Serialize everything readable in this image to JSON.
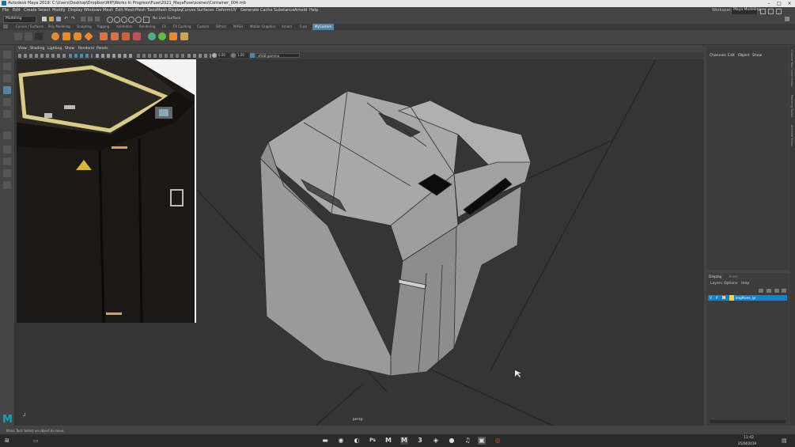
{
  "title_bar": {
    "title": "Autodesk Maya 2019: C:\\Users\\Desktop\\Dropbox\\WIP\\Works In Progress\\Fuse\\2021_MayaFuse\\scenes\\Container_004.mb"
  },
  "menu_bar": {
    "items": [
      "File",
      "Edit",
      "Create",
      "Select",
      "Modify",
      "Display",
      "Windows",
      "Mesh",
      "Edit Mesh",
      "Mesh Tools",
      "Mesh Display",
      "Curves",
      "Surfaces",
      "Deform",
      "UV",
      "Generate",
      "Cache",
      "Substance",
      "Arnold",
      "Help"
    ],
    "workspace_label": "Workspace :",
    "workspace_value": "Maya Modeling"
  },
  "status_line": {
    "mode": "Modeling",
    "live_surface": "No Live Surface"
  },
  "shelf_tabs": [
    "Curves / Surfaces",
    "Poly Modeling",
    "Sculpting",
    "Rigging",
    "Animation",
    "Rendering",
    "FX",
    "FX Caching",
    "Custom",
    "Bifrost",
    "MASH",
    "Motion Graphics",
    "Arnold",
    "Fuse",
    "MyCustom"
  ],
  "active_shelf_tab": "MyCustom",
  "panel_menu": [
    "View",
    "Shading",
    "Lighting",
    "Show",
    "Renderer",
    "Panels"
  ],
  "panel_bar": {
    "exposure": "0.00",
    "gamma": "1.00",
    "color_space": "sRGB gamma"
  },
  "viewport": {
    "camera_label": "persp"
  },
  "channel_box": {
    "menu": [
      "Channels",
      "Edit",
      "Object",
      "Show"
    ]
  },
  "layer_editor": {
    "tabs": [
      "Display",
      "Anim"
    ],
    "menu": [
      "Layers",
      "Options",
      "Help"
    ],
    "layer_row": {
      "v": "V",
      "p": "P",
      "name": "ImgPlane_lyr"
    }
  },
  "side_tabs": [
    "Channel Box / Layer Editor",
    "Modeling Toolkit",
    "Attribute Editor"
  ],
  "help_line": {
    "text": "Move Tool: Select an object to move."
  },
  "taskbar": {
    "icons": [
      "folder-icon",
      "chrome-icon",
      "media-icon",
      "photoshop-icon",
      "maya-icon",
      "maya-icon-2",
      "three-icon",
      "substance-icon",
      "settings-icon",
      "headset-icon",
      "obs-icon"
    ],
    "time": "11:42",
    "date": "25/04/2019"
  },
  "colors": {
    "accent": "#5285a6",
    "layer_highlight": "#1f7fbf",
    "shelf_orange": "#e88a2e"
  }
}
